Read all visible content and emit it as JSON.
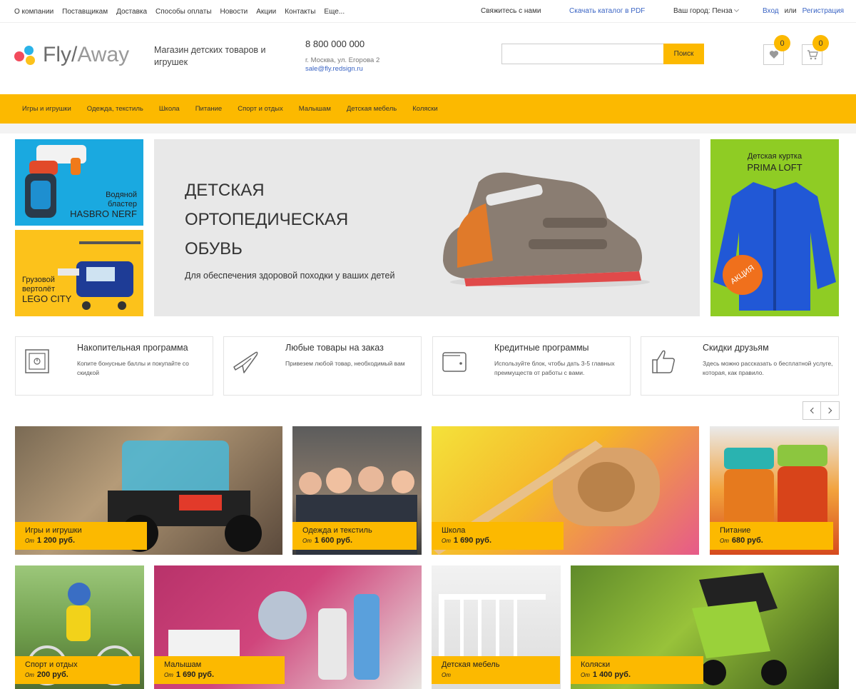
{
  "topbar": {
    "nav": [
      "О компании",
      "Поставщикам",
      "Доставка",
      "Способы оплаты",
      "Новости",
      "Акции",
      "Контакты",
      "Еще..."
    ],
    "contact": "Свяжитесь с нами",
    "catalog": "Скачать каталог в PDF",
    "city": "Ваш город: Пенза",
    "login": "Вход",
    "or": "или",
    "register": "Регистрация"
  },
  "header": {
    "logo_fly": "Fly/",
    "logo_away": "Away",
    "tagline": "Магазин детских товаров и игрушек",
    "phone": "8 800 000 000",
    "address": "г. Москва, ул. Егорова 2",
    "email": "sale@fly.redsign.ru",
    "search_placeholder": "",
    "search_button": "Поиск",
    "favorites_count": "0",
    "cart_count": "0"
  },
  "menu": [
    "Игры и игрушки",
    "Одежда, текстиль",
    "Школа",
    "Питание",
    "Спорт и отдых",
    "Малышам",
    "Детская мебель",
    "Коляски"
  ],
  "banners": {
    "left_top": {
      "line1": "Водяной",
      "line2": "бластер",
      "line3": "HASBRO NERF"
    },
    "left_bottom": {
      "line1": "Грузовой",
      "line2": "вертолёт",
      "line3": "LEGO CITY"
    },
    "main": {
      "title_1": "ДЕТСКАЯ",
      "title_2": "ОРТОПЕДИЧЕСКАЯ",
      "title_3": "ОБУВЬ",
      "subtitle": "Для обеспечения здоровой походки у ваших детей"
    },
    "right": {
      "line1": "Детская куртка",
      "line2": "PRIMA LOFT",
      "promo": "АКЦИЯ"
    }
  },
  "features": [
    {
      "title": "Накопительная программа",
      "desc": "Копите бонусные баллы и покупайте со скидкой",
      "icon": "safe-icon"
    },
    {
      "title": "Любые товары на заказ",
      "desc": "Привезем любой товар, необходимый вам",
      "icon": "airplane-icon"
    },
    {
      "title": "Кредитные программы",
      "desc": "Используйте блок, чтобы дать 3-5 главных преимуществ от работы с вами.",
      "icon": "wallet-icon"
    },
    {
      "title": "Скидки друзьям",
      "desc": "Здесь можно рассказать о бесплатной услуге, которая, как правило.",
      "icon": "thumbs-up-icon"
    }
  ],
  "categories": [
    {
      "name": "Игры и игрушки",
      "from": "От",
      "price": "1 200 руб."
    },
    {
      "name": "Одежда и текстиль",
      "from": "От",
      "price": "1 600 руб."
    },
    {
      "name": "Школа",
      "from": "От",
      "price": "1 690 руб."
    },
    {
      "name": "Питание",
      "from": "От",
      "price": "680 руб."
    },
    {
      "name": "Спорт и отдых",
      "from": "От",
      "price": "200 руб."
    },
    {
      "name": "Малышам",
      "from": "От",
      "price": "1 690 руб."
    },
    {
      "name": "Детская мебель",
      "from": "От",
      "price": ""
    },
    {
      "name": "Коляски",
      "from": "От",
      "price": "1 400 руб."
    }
  ],
  "colors": {
    "accent": "#fcb900",
    "link": "#3a64c4"
  }
}
